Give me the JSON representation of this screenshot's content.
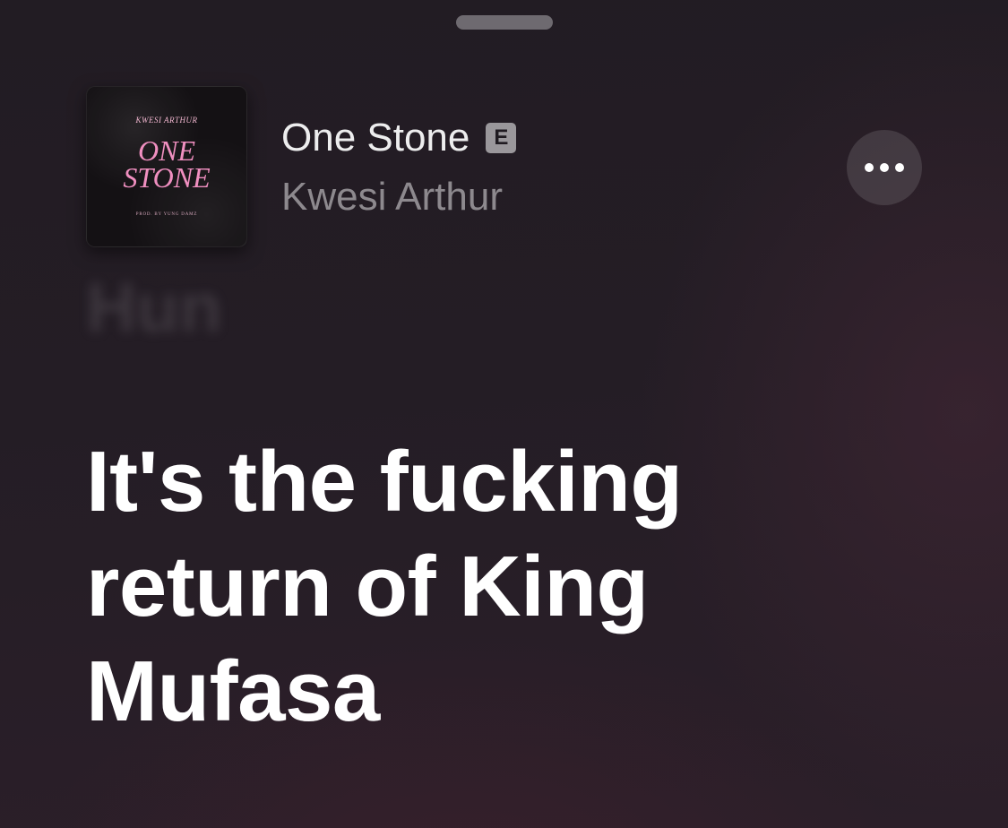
{
  "sheet": {
    "grabber": "sheet-grabber"
  },
  "now_playing": {
    "artwork": {
      "artist_text": "KWESI ARTHUR",
      "title_text": "ONE\nSTONE",
      "producer_text": "PROD. BY YUNG DAMZ"
    },
    "song_title": "One Stone",
    "explicit_badge": "E",
    "artist": "Kwesi Arthur",
    "more_icon": "ellipsis-icon"
  },
  "lyrics": {
    "previous_line": "Hun",
    "current_line": "It's the fucking return of King Mufasa"
  },
  "colors": {
    "background": "#241d25",
    "title": "#ededee",
    "artist": "#8d898e",
    "badge": "#9a979b",
    "lyric": "#ffffff",
    "artwork_text": "#f08fc0"
  }
}
